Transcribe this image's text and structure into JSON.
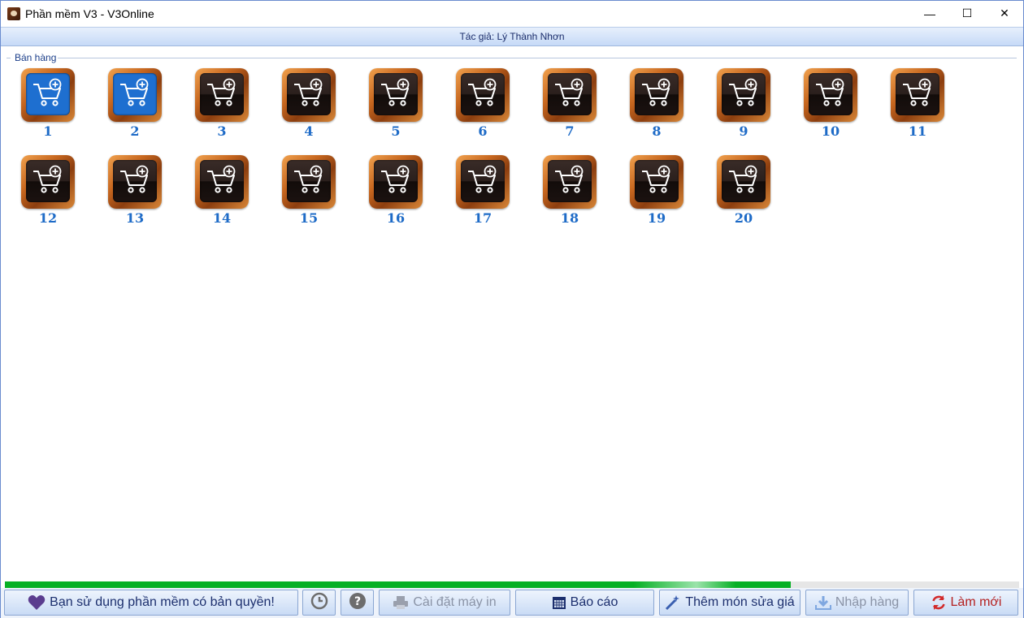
{
  "window": {
    "title": "Phần mềm V3 - V3Online",
    "controls": {
      "minimize": "—",
      "maximize": "☐",
      "close": "✕"
    }
  },
  "subtitle": "Tác giả: Lý Thành Nhơn",
  "section_label": "Bán hàng",
  "tiles": [
    {
      "label": "1",
      "active": true
    },
    {
      "label": "2",
      "active": true
    },
    {
      "label": "3"
    },
    {
      "label": "4"
    },
    {
      "label": "5"
    },
    {
      "label": "6"
    },
    {
      "label": "7"
    },
    {
      "label": "8"
    },
    {
      "label": "9"
    },
    {
      "label": "10"
    },
    {
      "label": "11"
    },
    {
      "label": "12"
    },
    {
      "label": "13"
    },
    {
      "label": "14"
    },
    {
      "label": "15"
    },
    {
      "label": "16"
    },
    {
      "label": "17"
    },
    {
      "label": "18"
    },
    {
      "label": "19"
    },
    {
      "label": "20"
    }
  ],
  "progress": {
    "fraction": 0.775
  },
  "colors": {
    "accent": "#1e6bc7",
    "progress": "#06b025",
    "active_tile": "#1e6fd0"
  },
  "toolbar": {
    "license": "Bạn sử dụng phần mềm có bản quyền!",
    "history_icon": "clock-icon",
    "help_icon": "question-icon",
    "printer": "Cài đặt máy in",
    "report": "Báo cáo",
    "add_item": "Thêm món sửa giá",
    "import": "Nhập hàng",
    "refresh": "Làm mới"
  }
}
